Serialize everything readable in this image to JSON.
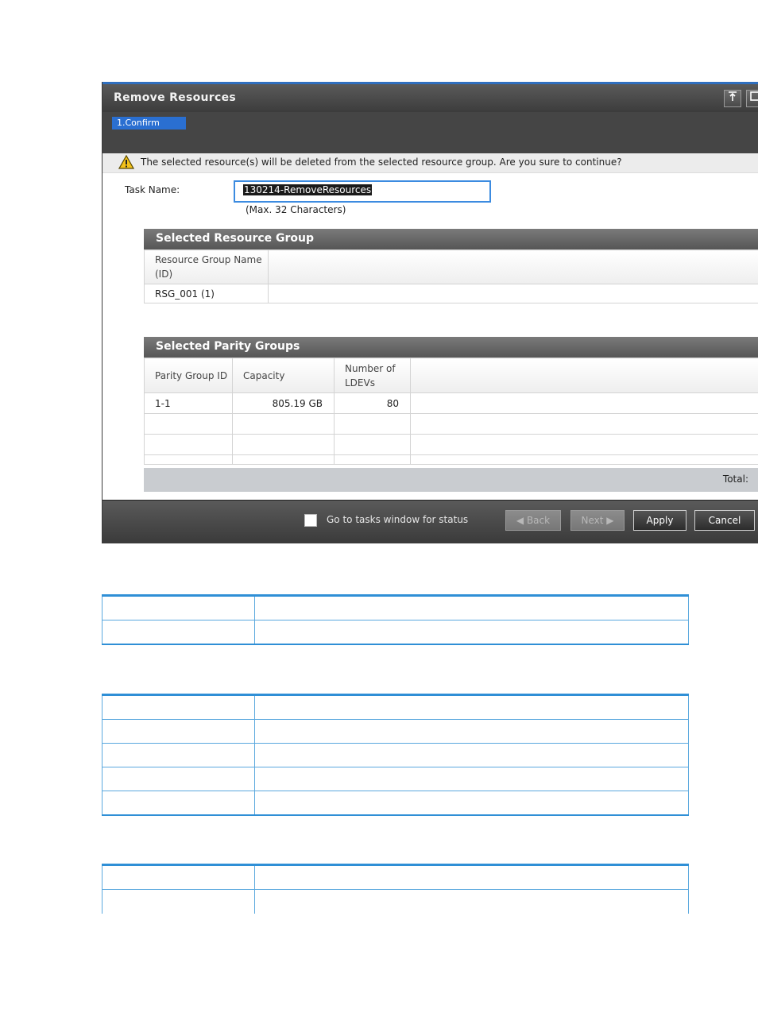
{
  "dialog": {
    "title": "Remove Resources",
    "title_buttons": [
      "pin-icon",
      "maximize-icon"
    ],
    "steps": [
      {
        "label": "1.Confirm",
        "active": true
      }
    ],
    "warning": {
      "icon": "warning-icon",
      "message": "The selected resource(s) will be deleted from the selected resource group. Are you sure to continue?"
    },
    "task_name": {
      "label": "Task Name:",
      "value": "130214-RemoveResources",
      "hint": "(Max. 32 Characters)"
    },
    "resource_group": {
      "heading": "Selected Resource Group",
      "columns": [
        "Resource Group Name (ID)"
      ],
      "rows": [
        [
          "RSG_001 (1)"
        ]
      ]
    },
    "parity_groups": {
      "heading": "Selected Parity Groups",
      "columns": [
        "Parity Group ID",
        "Capacity",
        "Number of LDEVs"
      ],
      "rows": [
        [
          "1-1",
          "805.19 GB",
          "80"
        ]
      ],
      "total_label": "Total:"
    },
    "footer": {
      "checkbox_label": "Go to tasks window for status",
      "checkbox_checked": false,
      "back_label": "Back",
      "next_label": "Next",
      "apply_label": "Apply",
      "cancel_label": "Cancel"
    }
  },
  "colors": {
    "accent": "#2a6fd1",
    "table_rule": "#2f8fd6",
    "title_bar": "#4a4a4a"
  }
}
